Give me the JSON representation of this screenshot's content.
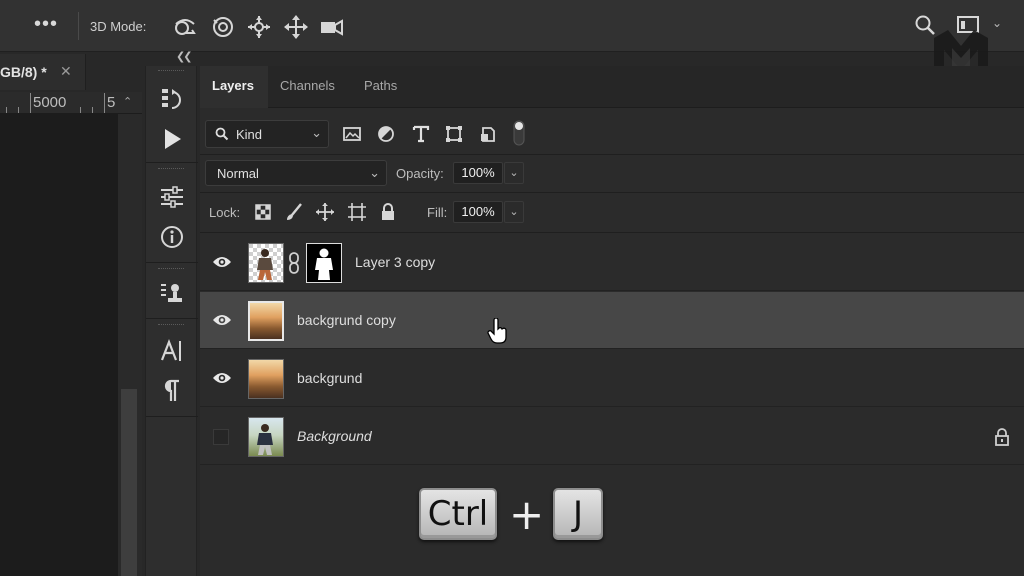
{
  "toolbar": {
    "more": "•••",
    "mode_label": "3D Mode:"
  },
  "document": {
    "tab_title": "GB/8) *",
    "close": "✕",
    "ruler_numbers": [
      "5000",
      "5"
    ]
  },
  "panel": {
    "tabs": [
      {
        "label": "Layers",
        "active": true
      },
      {
        "label": "Channels",
        "active": false
      },
      {
        "label": "Paths",
        "active": false
      }
    ],
    "filter_kind": "Kind",
    "blend_mode": "Normal",
    "opacity_label": "Opacity:",
    "opacity_value": "100%",
    "lock_label": "Lock:",
    "fill_label": "Fill:",
    "fill_value": "100%"
  },
  "layers": [
    {
      "name": "Layer 3 copy",
      "visible": true,
      "selected": false,
      "has_mask": true,
      "italic": false
    },
    {
      "name": "backgrund copy",
      "visible": true,
      "selected": true,
      "has_mask": false,
      "italic": false
    },
    {
      "name": "backgrund",
      "visible": true,
      "selected": false,
      "has_mask": false,
      "italic": false
    },
    {
      "name": "Background",
      "visible": false,
      "selected": false,
      "has_mask": false,
      "italic": true,
      "locked": true
    }
  ],
  "shortcut": {
    "key1": "Ctrl",
    "plus": "+",
    "key2": "J"
  },
  "colors": {
    "panel_bg": "#2b2b2b",
    "selected_row": "#474747",
    "topbar": "#323232"
  }
}
